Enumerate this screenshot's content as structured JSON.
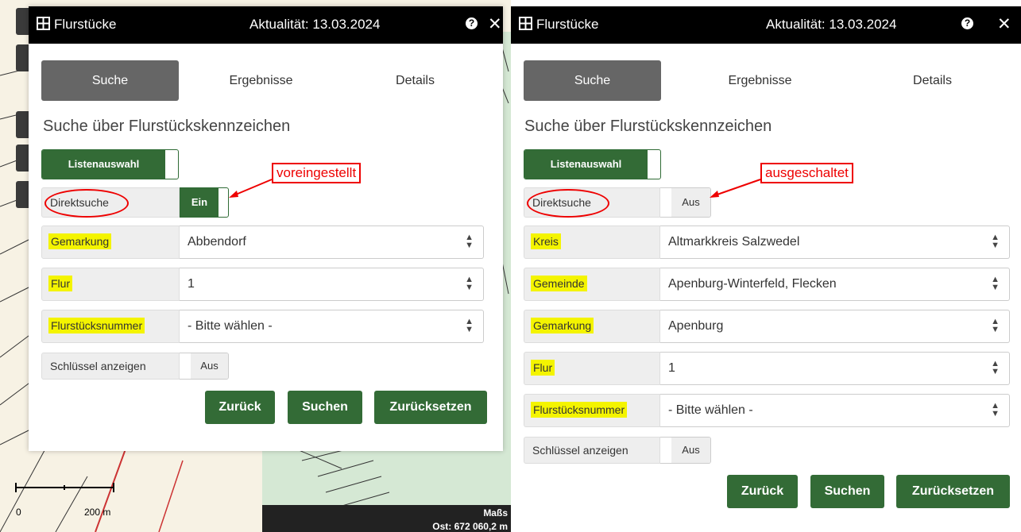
{
  "colors": {
    "accent": "#336b36",
    "header": "#000000",
    "highlight": "#f4f400",
    "annotation": "#ee0000"
  },
  "map": {
    "scale_zero": "0",
    "scale_label": "200 m",
    "coord_title": "Maßs",
    "coord_value": "Ost: 672 060,2 m"
  },
  "left_panel": {
    "title": "Flurstücke",
    "aktualitaet": "Aktualität: 13.03.2024",
    "help_icon": "?",
    "close_icon": "✕",
    "tabs": [
      "Suche",
      "Ergebnisse",
      "Details"
    ],
    "section_title": "Suche über Flurstückskennzeichen",
    "listenauswahl": "Listenauswahl",
    "direktsuche_label": "Direktsuche",
    "direktsuche_state": "Ein",
    "annotation": "voreingestellt",
    "fields": [
      {
        "label": "Gemarkung",
        "value": "Abbendorf"
      },
      {
        "label": "Flur",
        "value": "1"
      },
      {
        "label": "Flurstücksnummer",
        "value": "- Bitte wählen -"
      }
    ],
    "schluessel_label": "Schlüssel anzeigen",
    "schluessel_state": "Aus",
    "buttons": [
      "Zurück",
      "Suchen",
      "Zurücksetzen"
    ]
  },
  "right_panel": {
    "title": "Flurstücke",
    "aktualitaet": "Aktualität: 13.03.2024",
    "help_icon": "?",
    "close_icon": "✕",
    "tabs": [
      "Suche",
      "Ergebnisse",
      "Details"
    ],
    "section_title": "Suche über Flurstückskennzeichen",
    "listenauswahl": "Listenauswahl",
    "direktsuche_label": "Direktsuche",
    "direktsuche_state": "Aus",
    "annotation": "ausgeschaltet",
    "fields": [
      {
        "label": "Kreis",
        "value": "Altmarkkreis Salzwedel"
      },
      {
        "label": "Gemeinde",
        "value": "Apenburg-Winterfeld, Flecken"
      },
      {
        "label": "Gemarkung",
        "value": "Apenburg"
      },
      {
        "label": "Flur",
        "value": "1"
      },
      {
        "label": "Flurstücksnummer",
        "value": "- Bitte wählen -"
      }
    ],
    "schluessel_label": "Schlüssel anzeigen",
    "schluessel_state": "Aus",
    "buttons": [
      "Zurück",
      "Suchen",
      "Zurücksetzen"
    ]
  }
}
